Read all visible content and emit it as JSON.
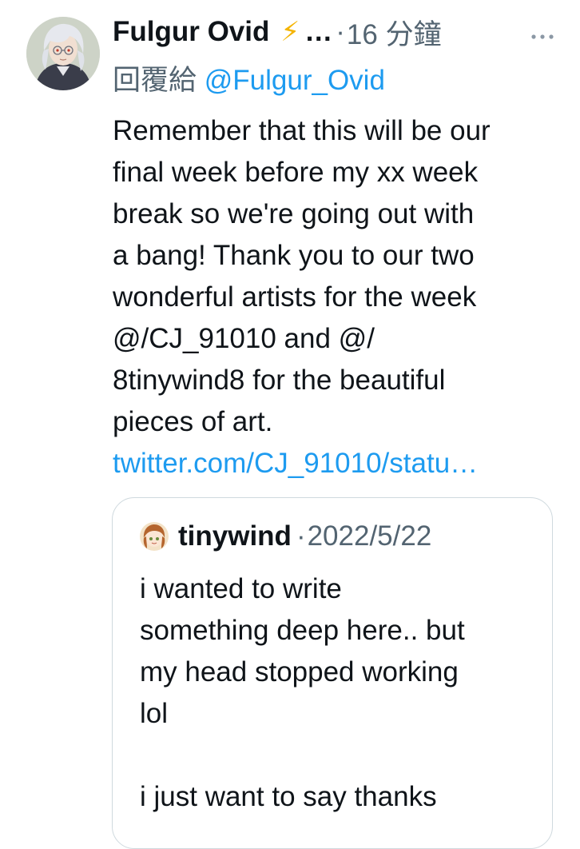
{
  "tweet": {
    "author_name": "Fulgur Ovid",
    "author_emoji": "⚡",
    "truncation": "…",
    "separator": "·",
    "time": "16 分鐘",
    "more_icon": "more-horizontal-icon",
    "reply_prefix": "回覆給",
    "reply_mention": "@Fulgur_Ovid",
    "body_lines": [
      "Remember that this will be our",
      "final week before my xx week",
      "break so we're going out with",
      "a bang! Thank you to our two",
      "wonderful artists for the week",
      "@/CJ_91010 and @/",
      "8tinywind8 for the beautiful",
      "pieces of art."
    ],
    "link": "twitter.com/CJ_91010/statu…"
  },
  "quote": {
    "author_name": "tinywind",
    "separator": "·",
    "date": "2022/5/22",
    "text_lines": [
      "i wanted to write",
      "something deep here.. but",
      "my head stopped working",
      "lol",
      "",
      "i just want to say thanks"
    ]
  },
  "colors": {
    "text": "#0f1419",
    "secondary": "#536471",
    "link": "#1d9bf0",
    "bolt": "#f4b400",
    "border": "#cfd9de"
  }
}
